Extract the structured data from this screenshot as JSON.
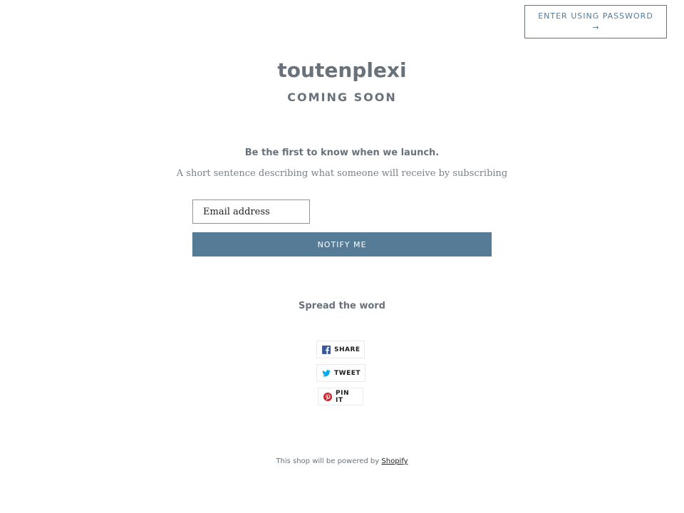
{
  "header": {
    "password_button_label": "ENTER USING PASSWORD",
    "password_button_arrow": "→"
  },
  "store": {
    "name": "toutenplexi",
    "status": "COMING SOON"
  },
  "newsletter": {
    "headline": "Be the first to know when we launch.",
    "description": "A short sentence describing what someone will receive by subscribing",
    "email_placeholder": "Email address",
    "submit_label": "NOTIFY ME"
  },
  "social": {
    "heading": "Spread the word",
    "buttons": [
      {
        "label": "SHARE",
        "icon": "facebook-icon"
      },
      {
        "label": "TWEET",
        "icon": "twitter-icon"
      },
      {
        "label": "PIN IT",
        "icon": "pinterest-icon"
      }
    ]
  },
  "footer": {
    "text": "This shop will be powered by",
    "link_label": "Shopify"
  },
  "colors": {
    "accent": "#557b97",
    "text": "#69727b",
    "facebook": "#3b5998",
    "twitter": "#00aced",
    "pinterest": "#cb2027"
  }
}
